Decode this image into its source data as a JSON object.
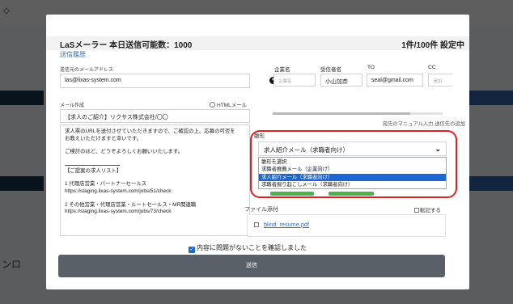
{
  "background": {
    "sidebar_text": "ンロ"
  },
  "modal": {
    "title": "LaSメーラー 本日送信可能数：1000",
    "count": "1件/100件 設定中",
    "history_link": "送信履歴",
    "sender": {
      "label": "送信元のメールアドレス",
      "value": "las@lixas-system.com"
    },
    "compose": {
      "label": "メール作成",
      "html_mail_label": "HTMLメール",
      "subject": "【求人のご紹介】リクサス株式会社/〇〇",
      "body_lines": [
        "求人票のURLを送付させていただきますので、ご確認の上、応募の可否を",
        "お教えいただけますと幸いです。",
        "",
        "ご検討のほど、どうぞよろしくお願いいたします。",
        "",
        "---RULE---",
        "【ご提案の求人リスト】",
        "",
        "1 代理店営業・パートナーセールス",
        "https://staging.lixas-system.com/jobs/51/check",
        "",
        "2 その他営業・代理店営業・ルートセールス・MR関連職",
        "https://staging.lixas-system.com/jobs/73/check"
      ]
    },
    "recipients": {
      "headers": {
        "company": "企業名",
        "recipient": "受信者名",
        "to": "TO",
        "cc": "CC"
      },
      "row": {
        "company_placeholder": "企業名",
        "recipient": "小山加奈",
        "to": "seal@gmail.com",
        "cc_placeholder": "追加"
      }
    },
    "links_text": "宛先のマニュアル入力 送信先の追加",
    "style": {
      "label": "雛形",
      "selected": "求人紹介メール（求職者向け）",
      "options": [
        "雛形を選択",
        "求職者推薦メール（企業向け）",
        "求人紹介メール（求職者向け）",
        "求職者掘り起こしメール（求職者向け）"
      ],
      "selected_index": 2
    },
    "attachments": {
      "label": "ファイル添付",
      "tenki_label": "転記する",
      "files": [
        "blind_resume.pdf"
      ]
    },
    "confirm_label": "内容に問題がないことを確認しました",
    "send_label": "送信"
  },
  "colors": {
    "accent_blue": "#1e66d2",
    "highlight_red": "#e02020",
    "send_button": "#5a6068"
  }
}
